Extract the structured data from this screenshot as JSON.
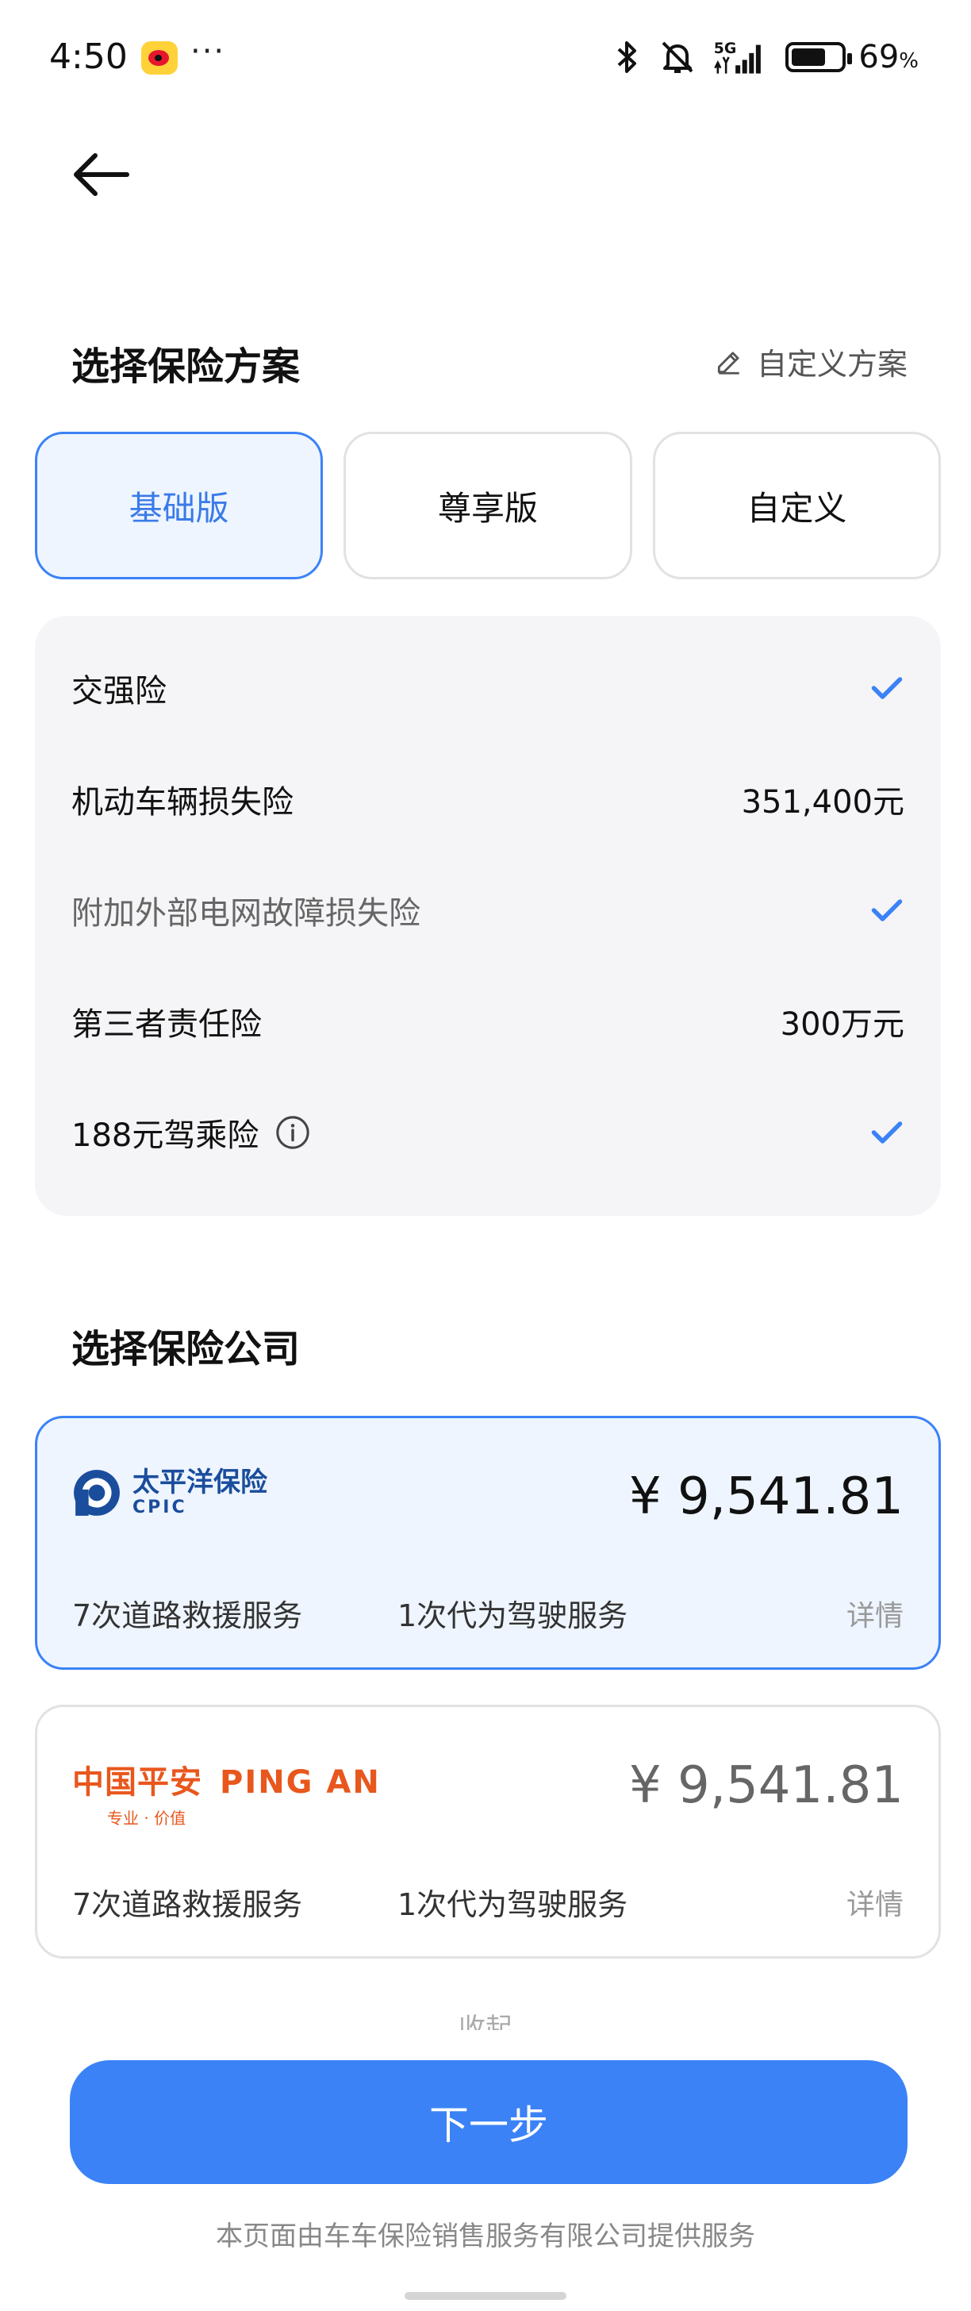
{
  "status_bar": {
    "time": "4:50",
    "more": "···",
    "network": "5G",
    "battery_percent": "69",
    "battery_unit": "%",
    "battery_level": 0.69
  },
  "plan_section": {
    "title": "选择保险方案",
    "custom_link": "自定义方案",
    "tabs": [
      {
        "label": "基础版",
        "active": true
      },
      {
        "label": "尊享版",
        "active": false
      },
      {
        "label": "自定义",
        "active": false
      }
    ]
  },
  "coverages": [
    {
      "label": "交强险",
      "value": null,
      "checked": true
    },
    {
      "label": "机动车辆损失险",
      "value": "351,400元",
      "checked": false
    },
    {
      "label": "附加外部电网故障损失险",
      "value": null,
      "checked": true
    },
    {
      "label": "第三者责任险",
      "value": "300万元",
      "checked": false
    },
    {
      "label": "188元驾乘险",
      "value": null,
      "checked": true
    }
  ],
  "company_section": {
    "title": "选择保险公司",
    "companies": [
      {
        "logo_cn": "太平洋保险",
        "logo_en": "CPIC",
        "price": "¥ 9,541.81",
        "service1": "7次道路救援服务",
        "service2": "1次代为驾驶服务",
        "detail": "详情",
        "selected": true
      },
      {
        "logo_cn": "中国平安",
        "logo_en": "PING AN",
        "logo_slogan": "专业 · 价值",
        "price": "¥ 9,541.81",
        "service1": "7次道路救援服务",
        "service2": "1次代为驾驶服务",
        "detail": "详情",
        "selected": false
      }
    ],
    "collapse_label": "收起"
  },
  "next_button": "下一步",
  "footer": "本页面由车车保险销售服务有限公司提供服务",
  "colors": {
    "accent": "#3b82f6",
    "active_bg": "#eef5ff",
    "panel_bg": "#f5f5f7",
    "cpic_blue": "#1a4d9c",
    "pingan_orange": "#e8571d"
  }
}
